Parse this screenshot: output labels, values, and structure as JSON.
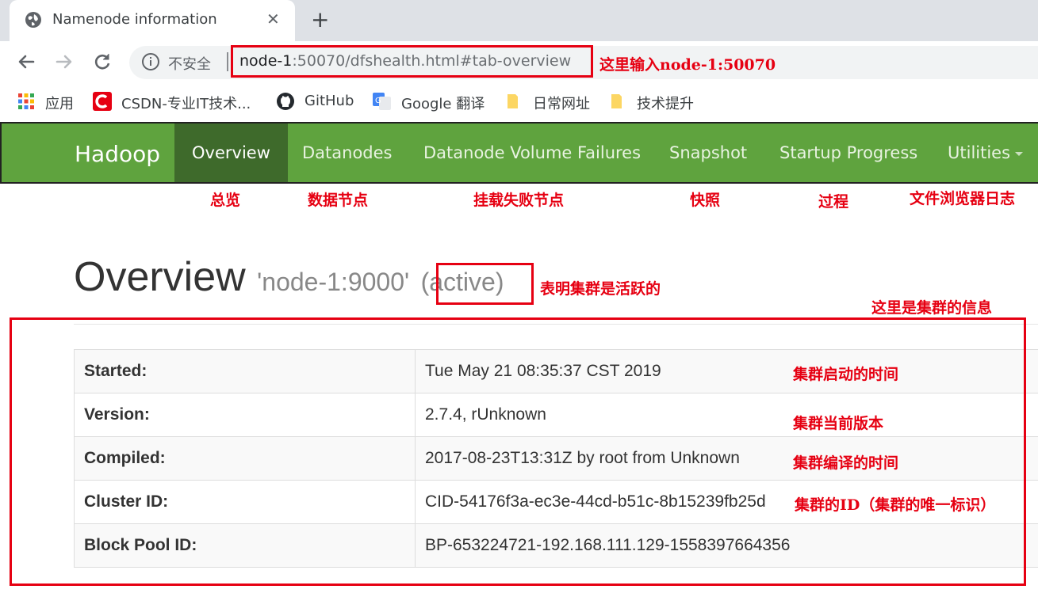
{
  "browser": {
    "tab_title": "Namenode information",
    "close_symbol": "✕",
    "new_tab_symbol": "+",
    "insecure_label": "不安全",
    "url_host": "node-1",
    "url_rest": ":50070/dfshealth.html#tab-overview",
    "bookmarks": [
      {
        "label": "应用",
        "icon": "apps-grid-icon"
      },
      {
        "label": "CSDN-专业IT技术...",
        "icon": "csdn-logo-icon"
      },
      {
        "label": "GitHub",
        "icon": "github-logo-icon"
      },
      {
        "label": "Google 翻译",
        "icon": "google-translate-icon"
      },
      {
        "label": "日常网址",
        "icon": "folder-icon"
      },
      {
        "label": "技术提升",
        "icon": "folder-icon"
      }
    ]
  },
  "navbar": {
    "brand": "Hadoop",
    "items": [
      {
        "label": "Overview",
        "active": true
      },
      {
        "label": "Datanodes"
      },
      {
        "label": "Datanode Volume Failures"
      },
      {
        "label": "Snapshot"
      },
      {
        "label": "Startup Progress"
      },
      {
        "label": "Utilities"
      }
    ]
  },
  "page": {
    "title": "Overview",
    "subtitle_node": "'node-1:9000'",
    "subtitle_state": "(active)"
  },
  "info_table": [
    {
      "key": "Started:",
      "value": "Tue May 21 08:35:37 CST 2019"
    },
    {
      "key": "Version:",
      "value": "2.7.4, rUnknown"
    },
    {
      "key": "Compiled:",
      "value": "2017-08-23T13:31Z by root from Unknown"
    },
    {
      "key": "Cluster ID:",
      "value": "CID-54176f3a-ec3e-44cd-b51c-8b15239fb25d"
    },
    {
      "key": "Block Pool ID:",
      "value": "BP-653224721-192.168.111.129-1558397664356"
    }
  ],
  "annotations": {
    "url_note": "这里输入node-1:50070",
    "nav_overview": "总览",
    "nav_datanodes": "数据节点",
    "nav_volume_failures": "挂载失败节点",
    "nav_snapshot": "快照",
    "nav_startup": "过程",
    "nav_utilities": "文件浏览器日志",
    "active_note": "表明集群是活跃的",
    "info_note": "这里是集群的信息",
    "started_note": "集群启动的时间",
    "version_note": "集群当前版本",
    "compiled_note": "集群编译的时间",
    "cluster_id_note": "集群的ID（集群的唯一标识）"
  },
  "colors": {
    "navbar_green": "#5fa33e",
    "navbar_active": "#3e6a2b",
    "annotation_red": "#e60012"
  }
}
